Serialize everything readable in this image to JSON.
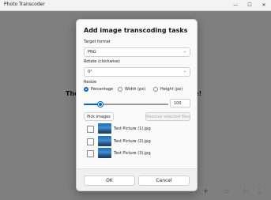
{
  "window": {
    "title": "Photo Transcoder",
    "minimize_glyph": "—",
    "maximize_glyph": "☐",
    "close_glyph": "✕"
  },
  "background": {
    "message_left": "The",
    "message_right": "one!",
    "toolbar_icons": [
      "add-icon",
      "clear-icon",
      "play-icon",
      "pane-icon"
    ],
    "toolbar_glyphs": [
      "+",
      "▭",
      "▷",
      "▯"
    ]
  },
  "dialog": {
    "title": "Add image transcoding tasks",
    "target_format": {
      "label": "Target format",
      "value": "PNG"
    },
    "rotate": {
      "label": "Rotate (clockwise)",
      "value": "0°"
    },
    "resize": {
      "label": "Resize",
      "options": [
        "Percentage",
        "Width (px)",
        "Height (px)"
      ],
      "selected": "Percentage",
      "value": "100",
      "slider_fraction": 0.2
    },
    "pick_images_label": "Pick images",
    "remove_selected_label": "Remove selected files",
    "files": [
      {
        "name": "Test Picture (1).jpg",
        "checked": false
      },
      {
        "name": "Test Picture (2).jpg",
        "checked": false
      },
      {
        "name": "Test Picture (3).jpg",
        "checked": false
      }
    ],
    "ok_label": "OK",
    "cancel_label": "Cancel"
  },
  "colors": {
    "accent": "#0067c0",
    "overlay": "#7f7f7f"
  }
}
